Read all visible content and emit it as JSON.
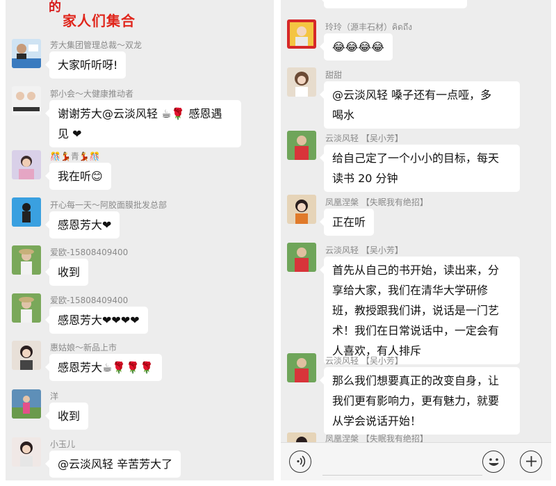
{
  "left": {
    "banner_text": "家人们集合",
    "messages": [
      {
        "name": "芳大集团管理总裁～双龙",
        "text": "大家听听呀!"
      },
      {
        "name": "郭小会～大健康推动者",
        "text_line1": "谢谢芳大@云淡风轻 ☕🌹 感恩遇",
        "text_line2": "见 ❤"
      },
      {
        "name": "🎊💃青💃🎊",
        "text": "我在听😊"
      },
      {
        "name": "开心每一天～阿胶面膜批发总部",
        "text": "感恩芳大❤"
      },
      {
        "name": "爱欧-15808409400",
        "text": "收到"
      },
      {
        "name": "爱欧-15808409400",
        "text": "感恩芳大❤❤❤❤"
      },
      {
        "name": "惠姑娘～新品上市",
        "text": "感恩芳大☕🌹🌹🌹"
      },
      {
        "name": "洋",
        "text": "收到"
      },
      {
        "name": "小玉儿",
        "text": "@云淡风轻  辛苦芳大了"
      }
    ]
  },
  "right": {
    "messages": [
      {
        "name": "玲玲（源丰石材）คิดถึง",
        "text": "😂😂😂😂"
      },
      {
        "name": "甜甜",
        "lines": [
          "@云淡风轻  嗓子还有一点哑，多",
          "喝水"
        ]
      },
      {
        "name": "云淡风轻 【吴小芳】",
        "lines": [
          "给自己定了一个小小的目标，每天",
          "读书 20 分钟"
        ]
      },
      {
        "name": "凤凰涅槃 【失眠我有绝招】",
        "lines": [
          "正在听"
        ]
      },
      {
        "name": "云淡风轻 【吴小芳】",
        "lines": [
          "首先从自己的书开始，读出来，分",
          "享给大家，我们在清华大学研修",
          "班，教授跟我们讲，说话是一门艺",
          "术！我们在日常说话中，一定会有",
          "人喜欢，有人排斥"
        ]
      },
      {
        "name": "云淡风轻 【吴小芳】",
        "lines": [
          "那么我们想要真正的改变自身，让",
          "我们更有影响力，更有魅力，就要",
          "从学会说话开始！"
        ]
      },
      {
        "name": "凤凰涅槃 【失眠我有绝招】"
      }
    ],
    "toolbar": {
      "voice_icon": "voice-icon",
      "emoji_icon": "emoji-icon",
      "plus_icon": "plus-icon"
    }
  }
}
